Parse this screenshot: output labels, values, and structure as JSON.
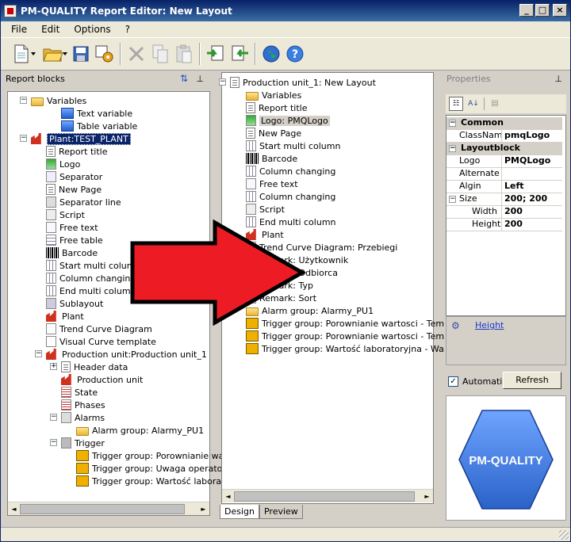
{
  "window": {
    "title": "PM-QUALITY Report Editor: New Layout",
    "buttons": {
      "minimize": "_",
      "maximize": "□",
      "close": "×"
    }
  },
  "menu": [
    "File",
    "Edit",
    "Options",
    "?"
  ],
  "toolbar": [
    "new-document-icon",
    "open-folder-icon",
    "save-icon",
    "settings-tool-icon",
    "delete-icon",
    "copy-icon",
    "paste-icon",
    "import-icon",
    "export-icon",
    "globe-icon",
    "help-icon"
  ],
  "left_panel": {
    "title": "Report blocks",
    "items": [
      {
        "label": "Variables",
        "icon": "folder-icon",
        "level": 1,
        "exp": "−"
      },
      {
        "label": "Text variable",
        "icon": "text-variable-icon",
        "level": 3
      },
      {
        "label": "Table variable",
        "icon": "table-variable-icon",
        "level": 3
      },
      {
        "label": "Plant:TEST_PLANT",
        "icon": "plant-icon",
        "level": 1,
        "exp": "−",
        "selected": true
      },
      {
        "label": "Report title",
        "icon": "page-icon",
        "level": 2
      },
      {
        "label": "Logo",
        "icon": "logo-icon",
        "level": 2
      },
      {
        "label": "Separator",
        "icon": "separator-icon",
        "level": 2
      },
      {
        "label": "New Page",
        "icon": "page-icon",
        "level": 2
      },
      {
        "label": "Separator line",
        "icon": "separator-line-icon",
        "level": 2
      },
      {
        "label": "Script",
        "icon": "script-icon",
        "level": 2
      },
      {
        "label": "Free text",
        "icon": "text-icon",
        "level": 2
      },
      {
        "label": "Free table",
        "icon": "table-icon",
        "level": 2
      },
      {
        "label": "Barcode",
        "icon": "barcode-icon",
        "level": 2
      },
      {
        "label": "Start multi column",
        "icon": "column-icon",
        "level": 2
      },
      {
        "label": "Column changing",
        "icon": "column-icon",
        "level": 2
      },
      {
        "label": "End multi column",
        "icon": "column-icon",
        "level": 2
      },
      {
        "label": "Sublayout",
        "icon": "sublayout-icon",
        "level": 2
      },
      {
        "label": "Plant",
        "icon": "plant-icon",
        "level": 2
      },
      {
        "label": "Trend Curve Diagram",
        "icon": "trend-icon",
        "level": 2
      },
      {
        "label": "Visual Curve template",
        "icon": "curve-icon",
        "level": 2
      },
      {
        "label": "Production unit:Production unit_1",
        "icon": "production-unit-icon",
        "level": 2,
        "exp": "−"
      },
      {
        "label": "Header data",
        "icon": "page-icon",
        "level": 3,
        "exp": "+"
      },
      {
        "label": "Production unit",
        "icon": "production-unit-icon",
        "level": 3
      },
      {
        "label": "State",
        "icon": "list-icon",
        "level": 3
      },
      {
        "label": "Phases",
        "icon": "list-icon",
        "level": 3
      },
      {
        "label": "Alarms",
        "icon": "alarm-icon",
        "level": 3,
        "exp": "−"
      },
      {
        "label": "Alarm group: Alarmy_PU1",
        "icon": "folder-icon",
        "level": 4
      },
      {
        "label": "Trigger",
        "icon": "trigger-icon",
        "level": 3,
        "exp": "−"
      },
      {
        "label": "Trigger group: Porownianie wart",
        "icon": "trigger-group-icon",
        "level": 4
      },
      {
        "label": "Trigger group: Uwaga operatora",
        "icon": "trigger-group-icon",
        "level": 4
      },
      {
        "label": "Trigger group: Wartość laborato",
        "icon": "trigger-group-icon",
        "level": 4
      }
    ]
  },
  "center_panel": {
    "items": [
      {
        "label": "Production unit_1: New Layout",
        "icon": "page-icon",
        "level": 0,
        "exp": "−"
      },
      {
        "label": "Variables",
        "icon": "folder-icon",
        "level": 1
      },
      {
        "label": "Report title",
        "icon": "page-icon",
        "level": 1
      },
      {
        "label": "Logo: PMQLogo",
        "icon": "logo-icon",
        "level": 1,
        "selected": true
      },
      {
        "label": "New Page",
        "icon": "page-icon",
        "level": 1
      },
      {
        "label": "Start multi column",
        "icon": "column-icon",
        "level": 1
      },
      {
        "label": "Barcode",
        "icon": "barcode-icon",
        "level": 1
      },
      {
        "label": "Column changing",
        "icon": "column-icon",
        "level": 1
      },
      {
        "label": "Free text",
        "icon": "text-icon",
        "level": 1
      },
      {
        "label": "Column changing",
        "icon": "column-icon",
        "level": 1
      },
      {
        "label": "Script",
        "icon": "script-icon",
        "level": 1
      },
      {
        "label": "End multi column",
        "icon": "column-icon",
        "level": 1
      },
      {
        "label": "Plant",
        "icon": "plant-icon",
        "level": 1
      },
      {
        "label": "Trend Curve Diagram: Przebiegi",
        "icon": "trend-icon",
        "level": 1
      },
      {
        "label": "Remark: Użytkownik",
        "icon": "remark-icon",
        "level": 1
      },
      {
        "label": "Remark: Odbiorca",
        "icon": "remark-icon",
        "level": 1
      },
      {
        "label": "Remark: Typ",
        "icon": "remark-icon",
        "level": 1
      },
      {
        "label": "Remark: Sort",
        "icon": "remark-icon",
        "level": 1
      },
      {
        "label": "Alarm group: Alarmy_PU1",
        "icon": "folder-icon",
        "level": 1
      },
      {
        "label": "Trigger group: Porownianie wartosci - Tem",
        "icon": "trigger-group-icon",
        "level": 1
      },
      {
        "label": "Trigger group: Porownianie wartosci - Tem",
        "icon": "trigger-group-icon",
        "level": 1
      },
      {
        "label": "Trigger group: Wartość laboratoryjna - Wa",
        "icon": "trigger-group-icon",
        "level": 1
      }
    ],
    "tabs": [
      "Design",
      "Preview"
    ]
  },
  "properties": {
    "title": "Properties",
    "rows": [
      {
        "type": "cat",
        "key": "Common"
      },
      {
        "key": "ClassName",
        "value": "pmqLogo"
      },
      {
        "type": "cat",
        "key": "Layoutblock"
      },
      {
        "key": "Logo",
        "value": "PMQLogo"
      },
      {
        "key": "Alternate te",
        "value": ""
      },
      {
        "key": "Algin",
        "value": "Left"
      },
      {
        "key": "Size",
        "value": "200; 200",
        "exp": "−"
      },
      {
        "key": "Width",
        "value": "200",
        "indent": true
      },
      {
        "key": "Height",
        "value": "200",
        "indent": true
      }
    ],
    "description_link": "Height",
    "automatic_label": "Automatic",
    "refresh_label": "Refresh",
    "logo_text": "PM-QUALITY"
  },
  "colors": {
    "arrow": "#ed1c24",
    "hexagon": "#3f7fe0",
    "selection": "#0a246a"
  }
}
